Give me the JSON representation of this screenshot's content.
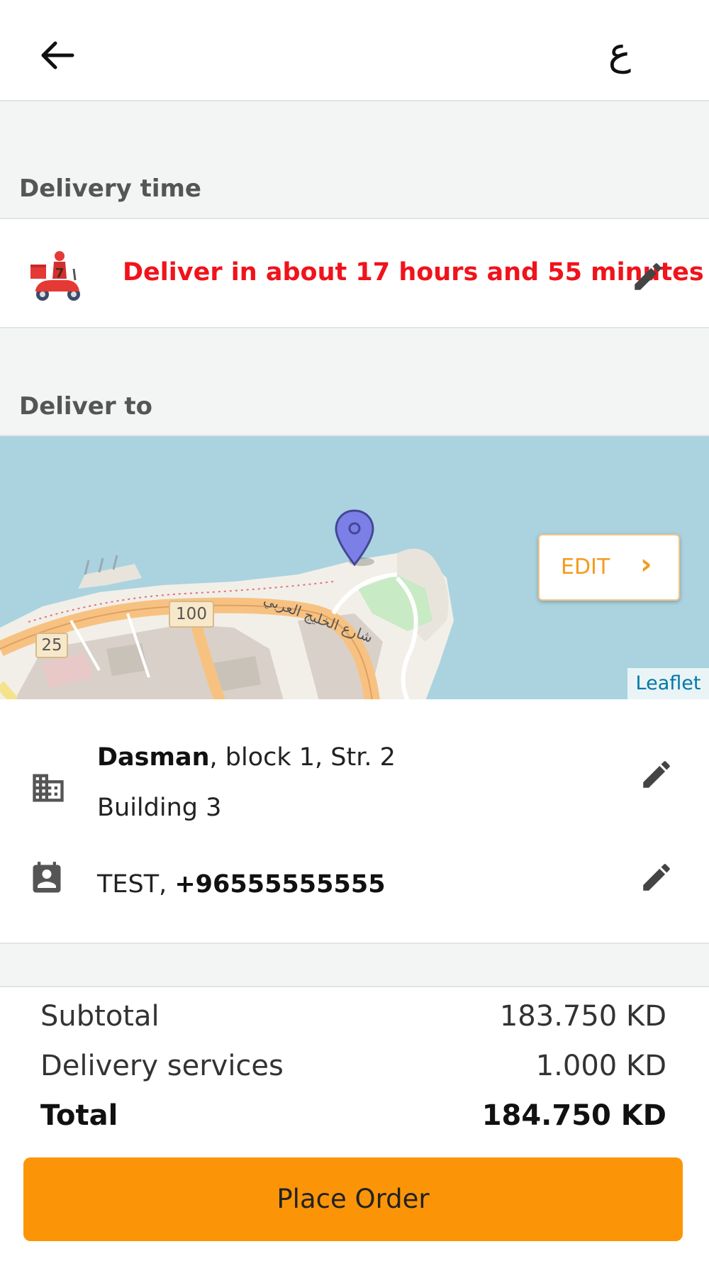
{
  "header": {
    "back_icon": "arrow-left-icon",
    "language_label": "ع"
  },
  "delivery_time": {
    "title": "Delivery time",
    "text": "Deliver in about 17 hours and 55 minutes",
    "text_color": "#f0131b",
    "icon": "delivery-scooter-icon",
    "edit_icon": "pencil-icon"
  },
  "deliver_to": {
    "title": "Deliver to",
    "map": {
      "edit_label": "EDIT",
      "edit_chevron": "›",
      "attribution": "Leaflet",
      "marker_icon": "map-pin-icon",
      "road_labels": [
        "100",
        "25",
        "شارع الخليج العربي"
      ]
    },
    "address": {
      "area": "Dasman",
      "rest": ", block 1, Str. 2",
      "building": "Building 3",
      "icon": "building-icon",
      "edit_icon": "pencil-icon"
    },
    "contact": {
      "name": "TEST, ",
      "phone": "+96555555555",
      "icon": "contact-card-icon",
      "edit_icon": "pencil-icon"
    }
  },
  "totals": {
    "subtotal_label": "Subtotal",
    "subtotal_value": "183.750 KD",
    "delivery_label": "Delivery services",
    "delivery_value": "1.000 KD",
    "total_label": "Total",
    "total_value": "184.750 KD"
  },
  "actions": {
    "place_order_label": "Place Order",
    "accent_color": "#fb9507"
  }
}
